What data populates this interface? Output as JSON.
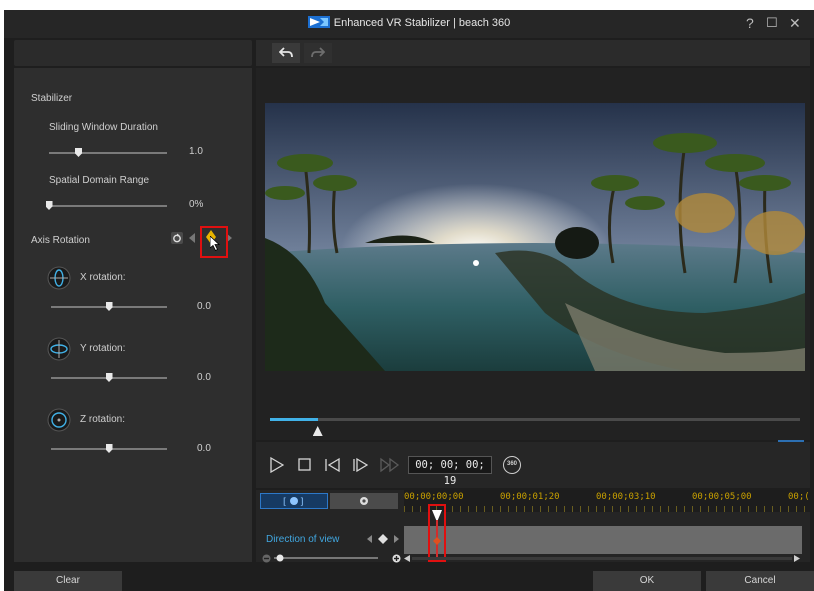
{
  "window": {
    "title": "Enhanced VR Stabilizer | beach 360",
    "help": "?",
    "maximize": "☐",
    "close": "✕"
  },
  "stabilizer": {
    "heading": "Stabilizer",
    "sliding_window": {
      "label": "Sliding Window Duration",
      "value": "1.0",
      "fraction": 0.25
    },
    "spatial_domain": {
      "label": "Spatial Domain Range",
      "value": "0%",
      "fraction": 0.0
    }
  },
  "axis_rotation": {
    "heading": "Axis Rotation",
    "x": {
      "label": "X rotation:",
      "value": "0.0",
      "fraction": 0.5
    },
    "y": {
      "label": "Y rotation:",
      "value": "0.0",
      "fraction": 0.5
    },
    "z": {
      "label": "Z rotation:",
      "value": "0.0",
      "fraction": 0.5
    }
  },
  "player": {
    "seek_fraction": 0.09,
    "timecode": "00; 00; 00; 19",
    "badge_360": "360"
  },
  "timeline": {
    "ruler_labels": [
      "00;00;00;00",
      "00;00;01;20",
      "00;00;03;10",
      "00;00;05;00",
      "00;("
    ],
    "track_label": "Direction of view"
  },
  "buttons": {
    "clear": "Clear",
    "ok": "OK",
    "cancel": "Cancel"
  },
  "colors": {
    "accent": "#41b2e8",
    "highlight": "#e01010",
    "keyframe": "#e8b400"
  }
}
